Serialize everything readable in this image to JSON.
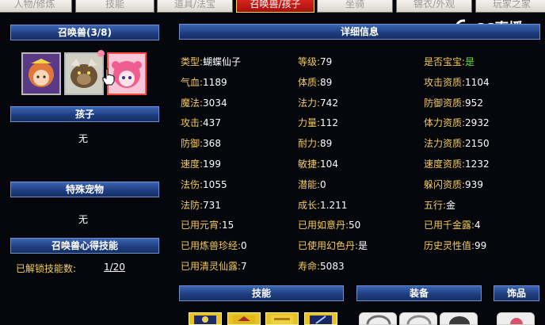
{
  "tabs": [
    {
      "label": "人物/修炼",
      "active": false
    },
    {
      "label": "技能",
      "active": false
    },
    {
      "label": "道具/法宝",
      "active": false
    },
    {
      "label": "召唤兽/孩子",
      "active": true
    },
    {
      "label": "坐骑",
      "active": false
    },
    {
      "label": "锦衣/外观",
      "active": false
    },
    {
      "label": "玩家之家",
      "active": false
    }
  ],
  "logo": {
    "text": "CC直播"
  },
  "left": {
    "summon_title": "召唤兽(3/8)",
    "child_title": "孩子",
    "child_value": "无",
    "special_title": "特殊宠物",
    "special_value": "无",
    "skill_title": "召唤兽心得技能",
    "unlocked_label": "已解锁技能数:",
    "unlocked_value": "1/20"
  },
  "detail": {
    "title": "详细信息",
    "col1": [
      {
        "key": "类型:",
        "value": "蝴蝶仙子"
      },
      {
        "key": "气血:",
        "value": "1189"
      },
      {
        "key": "魔法:",
        "value": "3034"
      },
      {
        "key": "攻击:",
        "value": "437"
      },
      {
        "key": "防御:",
        "value": "368"
      },
      {
        "key": "速度:",
        "value": "199"
      },
      {
        "key": "法伤:",
        "value": "1055"
      },
      {
        "key": "法防:",
        "value": "731"
      },
      {
        "key": "已用元宵:",
        "value": "15"
      },
      {
        "key": "已用炼兽珍经:",
        "value": "0"
      },
      {
        "key": "已用清灵仙露:",
        "value": "7"
      }
    ],
    "col2": [
      {
        "key": "等级:",
        "value": "79"
      },
      {
        "key": "体质:",
        "value": "89"
      },
      {
        "key": "法力:",
        "value": "742"
      },
      {
        "key": "力量:",
        "value": "112"
      },
      {
        "key": "耐力:",
        "value": "89"
      },
      {
        "key": "敏捷:",
        "value": "104"
      },
      {
        "key": "潜能:",
        "value": "0"
      },
      {
        "key": "成长:",
        "value": "1.211"
      },
      {
        "key": "已用如意丹:",
        "value": "50"
      },
      {
        "key": "已使用幻色丹:",
        "value": "是"
      },
      {
        "key": "寿命:",
        "value": "5083"
      }
    ],
    "col3": [
      {
        "key": "是否宝宝:",
        "value": "是"
      },
      {
        "key": "攻击资质:",
        "value": "1104"
      },
      {
        "key": "防御资质:",
        "value": "952"
      },
      {
        "key": "体力资质:",
        "value": "2932"
      },
      {
        "key": "法力资质:",
        "value": "2150"
      },
      {
        "key": "速度资质:",
        "value": "1232"
      },
      {
        "key": "躲闪资质:",
        "value": "939"
      },
      {
        "key": "五行:",
        "value": "金"
      },
      {
        "key": "已用千金露:",
        "value": "4"
      },
      {
        "key": "历史灵性值:",
        "value": "99"
      }
    ]
  },
  "bottom": {
    "skills_title": "技能",
    "equip_title": "装备",
    "accessory_title": "饰品"
  }
}
